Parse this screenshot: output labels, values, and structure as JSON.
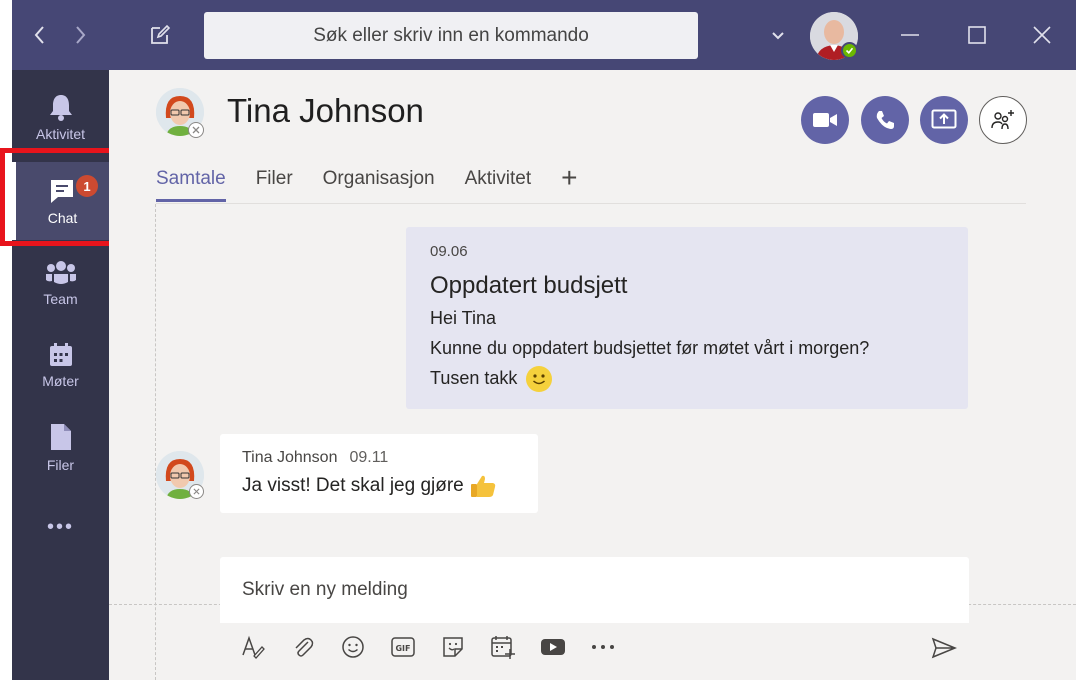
{
  "titlebar": {
    "search_placeholder": "Søk eller skriv inn en kommando",
    "back_icon": "chevron-left-icon",
    "forward_icon": "chevron-right-icon",
    "compose_icon": "new-chat-icon"
  },
  "rail": {
    "items": [
      {
        "label": "Aktivitet",
        "icon": "bell-icon"
      },
      {
        "label": "Chat",
        "icon": "chat-icon",
        "badge": "1"
      },
      {
        "label": "Team",
        "icon": "teams-icon"
      },
      {
        "label": "Møter",
        "icon": "calendar-icon"
      },
      {
        "label": "Filer",
        "icon": "file-icon"
      }
    ],
    "more": "•••"
  },
  "header": {
    "name": "Tina Johnson",
    "tabs": [
      "Samtale",
      "Filer",
      "Organisasjon",
      "Aktivitet"
    ],
    "tab_add": "+"
  },
  "messages": {
    "sent": {
      "time": "09.06",
      "subject": "Oppdatert budsjett",
      "lines": [
        "Hei Tina",
        "Kunne du oppdatert budsjettet før møtet vårt i morgen?",
        "Tusen takk"
      ]
    },
    "received": {
      "author": "Tina Johnson",
      "time": "09.11",
      "text": "Ja visst! Det skal jeg gjøre"
    }
  },
  "compose": {
    "placeholder": "Skriv en ny melding"
  },
  "colors": {
    "titlebar": "#464775",
    "rail": "#33344a",
    "accent": "#6264a7",
    "badge": "#cc4a31",
    "highlight": "#e8141c"
  }
}
